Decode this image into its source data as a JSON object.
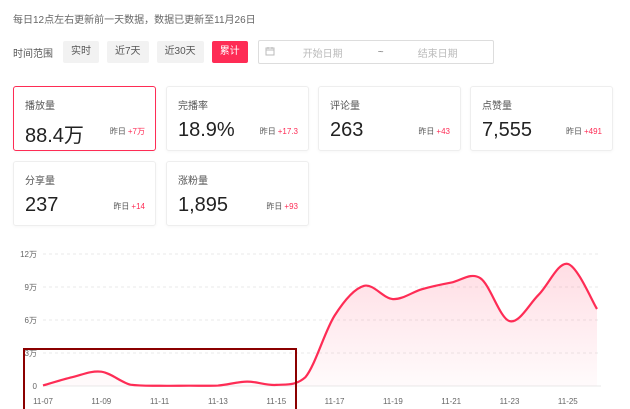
{
  "notice": "每日12点左右更新前一天数据，数据已更新至11月26日",
  "range": {
    "label": "时间范围",
    "buttons": [
      "实时",
      "近7天",
      "近30天",
      "累计"
    ],
    "active_index": 3,
    "start_placeholder": "开始日期",
    "separator": "~",
    "end_placeholder": "结束日期"
  },
  "cards": [
    {
      "title": "播放量",
      "value": "88.4万",
      "delta_label": "昨日",
      "delta": "+7万"
    },
    {
      "title": "完播率",
      "value": "18.9%",
      "delta_label": "昨日",
      "delta": "+17.3"
    },
    {
      "title": "评论量",
      "value": "263",
      "delta_label": "昨日",
      "delta": "+43"
    },
    {
      "title": "点赞量",
      "value": "7,555",
      "delta_label": "昨日",
      "delta": "+491"
    },
    {
      "title": "分享量",
      "value": "237",
      "delta_label": "昨日",
      "delta": "+14"
    },
    {
      "title": "涨粉量",
      "value": "1,895",
      "delta_label": "昨日",
      "delta": "+93"
    }
  ],
  "colors": {
    "accent": "#fe2c55",
    "highlight_box": "#8b0000"
  },
  "chart_data": {
    "type": "area",
    "y_ticks": [
      "0",
      "3万",
      "6万",
      "9万",
      "12万"
    ],
    "ylim": [
      0,
      120000
    ],
    "x_tick_labels": [
      "11-07",
      "11-09",
      "11-11",
      "11-13",
      "11-15",
      "11-17",
      "11-19",
      "11-21",
      "11-23",
      "11-25"
    ],
    "x": [
      "11-07",
      "11-08",
      "11-09",
      "11-10",
      "11-11",
      "11-12",
      "11-13",
      "11-14",
      "11-15",
      "11-16",
      "11-17",
      "11-18",
      "11-19",
      "11-20",
      "11-21",
      "11-22",
      "11-23",
      "11-24",
      "11-25",
      "11-26"
    ],
    "values": [
      500,
      8000,
      13000,
      1200,
      200,
      300,
      400,
      4000,
      1000,
      8000,
      64000,
      91000,
      79000,
      88000,
      94000,
      98000,
      59000,
      83000,
      111000,
      70000
    ],
    "grid": true
  }
}
